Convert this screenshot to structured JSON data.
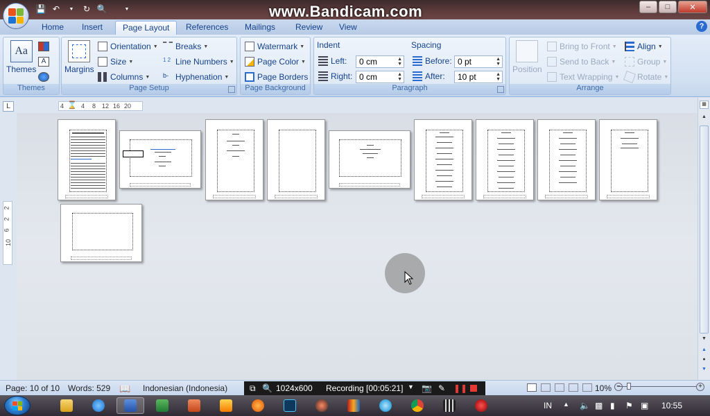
{
  "titlebar": {
    "watermark": "www.Bandicam.com",
    "minimize": "–",
    "maximize": "□",
    "close": "✕"
  },
  "tabs": [
    {
      "label": "Home"
    },
    {
      "label": "Insert"
    },
    {
      "label": "Page Layout"
    },
    {
      "label": "References"
    },
    {
      "label": "Mailings"
    },
    {
      "label": "Review"
    },
    {
      "label": "View"
    }
  ],
  "ribbon": {
    "themes": {
      "label": "Themes",
      "group": "Themes"
    },
    "page_setup": {
      "group": "Page Setup",
      "margins": "Margins",
      "orientation": "Orientation",
      "size": "Size",
      "columns": "Columns",
      "breaks": "Breaks",
      "line_numbers": "Line Numbers",
      "hyphenation": "Hyphenation"
    },
    "page_background": {
      "group": "Page Background",
      "watermark": "Watermark",
      "page_color": "Page Color",
      "page_borders": "Page Borders"
    },
    "paragraph": {
      "group": "Paragraph",
      "indent_label": "Indent",
      "left_label": "Left:",
      "left_value": "0 cm",
      "right_label": "Right:",
      "right_value": "0 cm",
      "spacing_label": "Spacing",
      "before_label": "Before:",
      "before_value": "0 pt",
      "after_label": "After:",
      "after_value": "10 pt"
    },
    "arrange": {
      "group": "Arrange",
      "position": "Position",
      "bring_to_front": "Bring to Front",
      "send_to_back": "Send to Back",
      "text_wrapping": "Text Wrapping",
      "align": "Align",
      "group_btn": "Group",
      "rotate": "Rotate"
    }
  },
  "ruler": {
    "corner": "L",
    "ticks_h": [
      "4",
      "4",
      "8",
      "12",
      "16",
      "20"
    ],
    "ticks_v": [
      "2",
      "2",
      "6",
      "10"
    ]
  },
  "statusbar": {
    "page": "Page: 10 of 10",
    "words": "Words: 529",
    "language": "Indonesian (Indonesia)",
    "resolution": "1024x600",
    "recording": "Recording [00:05:21]",
    "zoom": "10%"
  },
  "taskbar": {
    "lang": "IN",
    "time": "10:55"
  },
  "colors": {
    "ribbon_text": "#15428b",
    "accent_blue": "#2a6bd1"
  }
}
